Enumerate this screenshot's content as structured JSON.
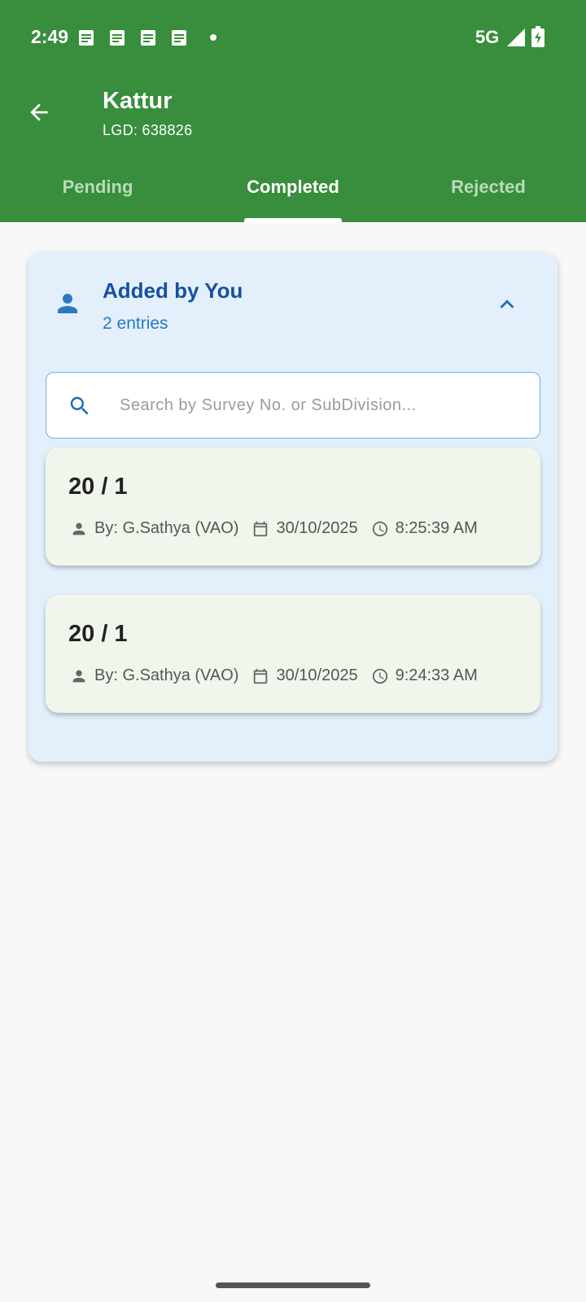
{
  "status_bar": {
    "time": "2:49",
    "network": "5G",
    "notification_icons": [
      "note-icon",
      "note-icon",
      "note-icon",
      "note-icon"
    ]
  },
  "header": {
    "title": "Kattur",
    "subtitle": "LGD: 638826",
    "back_icon": "arrow-back-icon"
  },
  "tabs": [
    {
      "label": "Pending",
      "active": false
    },
    {
      "label": "Completed",
      "active": true
    },
    {
      "label": "Rejected",
      "active": false
    }
  ],
  "panel": {
    "title": "Added by You",
    "subtitle": "2 entries",
    "icon": "person-icon",
    "expanded": true
  },
  "search": {
    "value": "",
    "placeholder": "Search by Survey No. or SubDivision..."
  },
  "entries": [
    {
      "title": "20 / 1",
      "by": "By: G.Sathya (VAO)",
      "date": "30/10/2025",
      "time": "8:25:39 AM"
    },
    {
      "title": "20 / 1",
      "by": "By: G.Sathya (VAO)",
      "date": "30/10/2025",
      "time": "9:24:33 AM"
    }
  ],
  "colors": {
    "app_bar": "#388e3c",
    "panel_bg": "#e3f0fb",
    "panel_title": "#1650a0",
    "accent_blue": "#2b79c2",
    "entry_bg": "#f1f6ec"
  }
}
